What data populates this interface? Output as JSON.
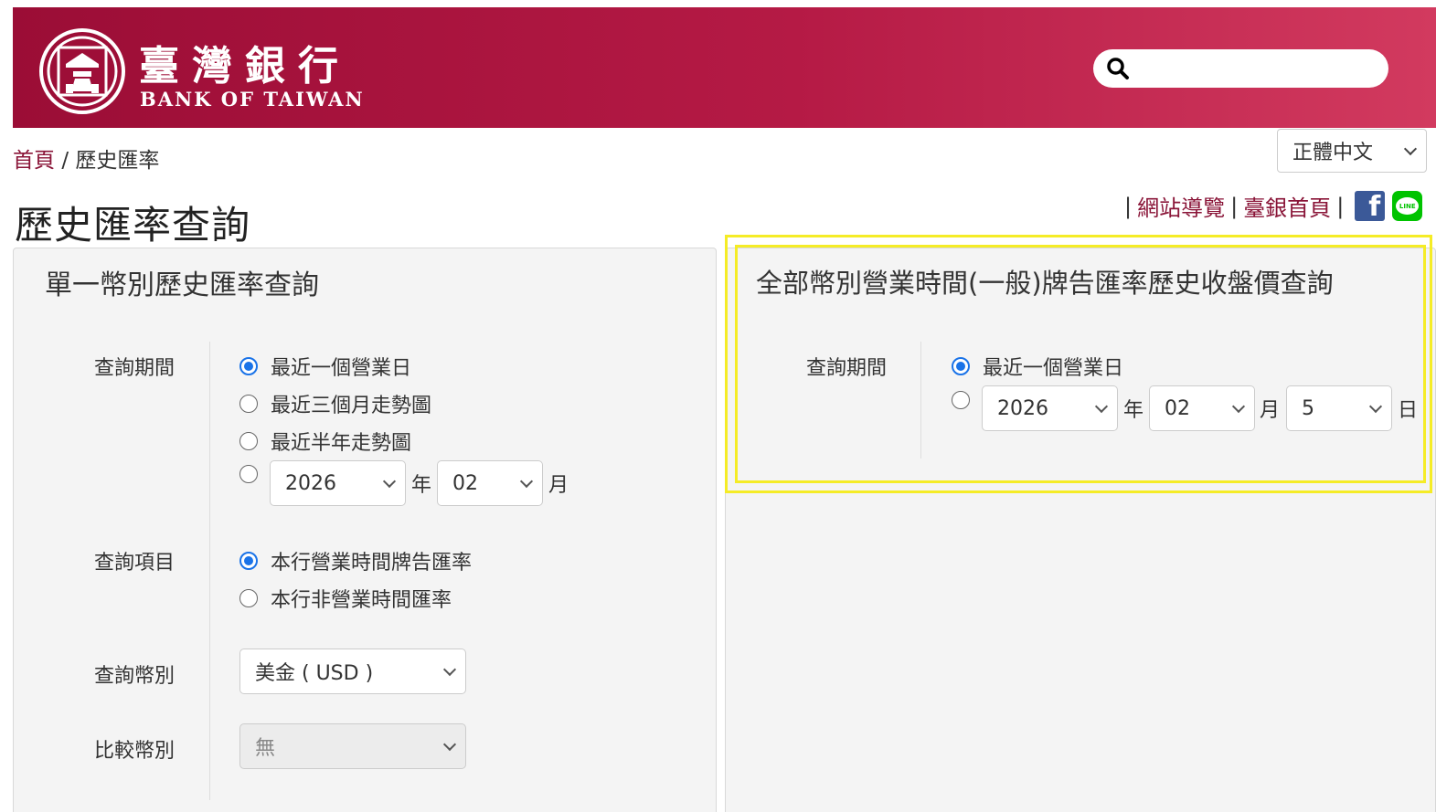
{
  "header": {
    "brand_cn": "臺灣銀行",
    "brand_en": "BANK OF TAIWAN",
    "search_placeholder": ""
  },
  "breadcrumb": {
    "home": "首頁",
    "separator": "/",
    "current": "歷史匯率"
  },
  "language": {
    "selected": "正體中文"
  },
  "page_title": "歷史匯率查詢",
  "top_links": {
    "sitemap": "網站導覽",
    "bank_home": "臺銀首頁",
    "sep": "|"
  },
  "left_panel": {
    "title": "單一幣別歷史匯率查詢",
    "period_label": "查詢期間",
    "period_options": [
      "最近一個營業日",
      "最近三個月走勢圖",
      "最近半年走勢圖"
    ],
    "year": "2026",
    "year_unit": "年",
    "month": "02",
    "month_unit": "月",
    "item_label": "查詢項目",
    "item_options": [
      "本行營業時間牌告匯率",
      "本行非營業時間匯率"
    ],
    "currency_label": "查詢幣別",
    "currency": "美金 ( USD )",
    "compare_label": "比較幣別",
    "compare": "無"
  },
  "right_panel": {
    "title": "全部幣別營業時間(一般)牌告匯率歷史收盤價查詢",
    "period_label": "查詢期間",
    "period_option": "最近一個營業日",
    "year": "2026",
    "year_unit": "年",
    "month": "02",
    "month_unit": "月",
    "day": "5",
    "day_unit": "日"
  },
  "colors": {
    "brand": "#9b0d36",
    "link": "#8a1538",
    "radio_checked": "#1a73e8",
    "highlight": "#f5ec26"
  }
}
